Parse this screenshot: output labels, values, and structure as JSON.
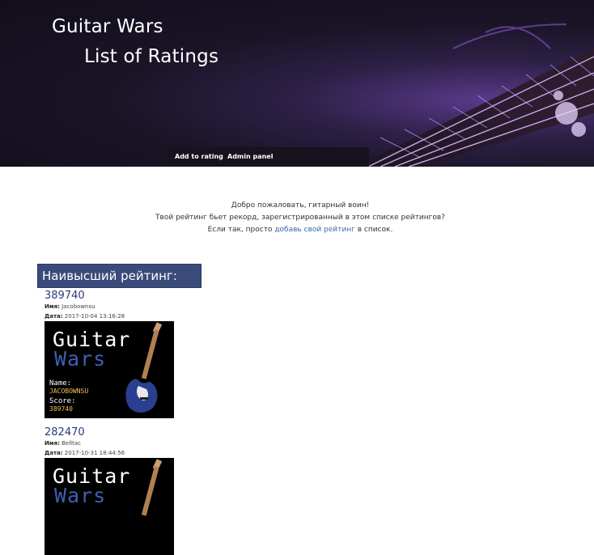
{
  "header": {
    "title": "Guitar Wars",
    "subtitle": "List of Ratings"
  },
  "nav": {
    "add_rating": "Add to rating",
    "admin_panel": "Admin panel"
  },
  "intro": {
    "line1": "Добро пожаловать, гитарный воин!",
    "line2": "Твой рейтинг бьет рекорд, зарегистрированный в этом списке рейтингов?",
    "line3_prefix": "Если так, просто",
    "line3_link": "добавь свой рейтинг",
    "line3_suffix": "в список."
  },
  "top_score": {
    "label": "Наивысший рейтинг:",
    "value": "389740"
  },
  "entries": [
    {
      "score": "389740",
      "name_label": "Имя:",
      "name": "Jacobownsu",
      "date_label": "Дата:",
      "date": "2017-10-04 13:16:28",
      "shot_title1": "Guitar",
      "shot_title2": "Wars",
      "shot_name_label": "Name:",
      "shot_name": "JACOBOWNSU",
      "shot_score_label": "Score:",
      "shot_score": "389740"
    },
    {
      "score": "282470",
      "name_label": "Имя:",
      "name": "Belltac",
      "date_label": "Дата:",
      "date": "2017-10-31 18:44:56",
      "shot_title1": "Guitar",
      "shot_title2": "Wars"
    }
  ],
  "colors": {
    "top_score_bg": "#3a4a7a",
    "score_text": "#2a3a7a",
    "link": "#3a6aa0",
    "shot_name_text": "#f0c050",
    "shot_wars_text": "#3f5fb0"
  }
}
